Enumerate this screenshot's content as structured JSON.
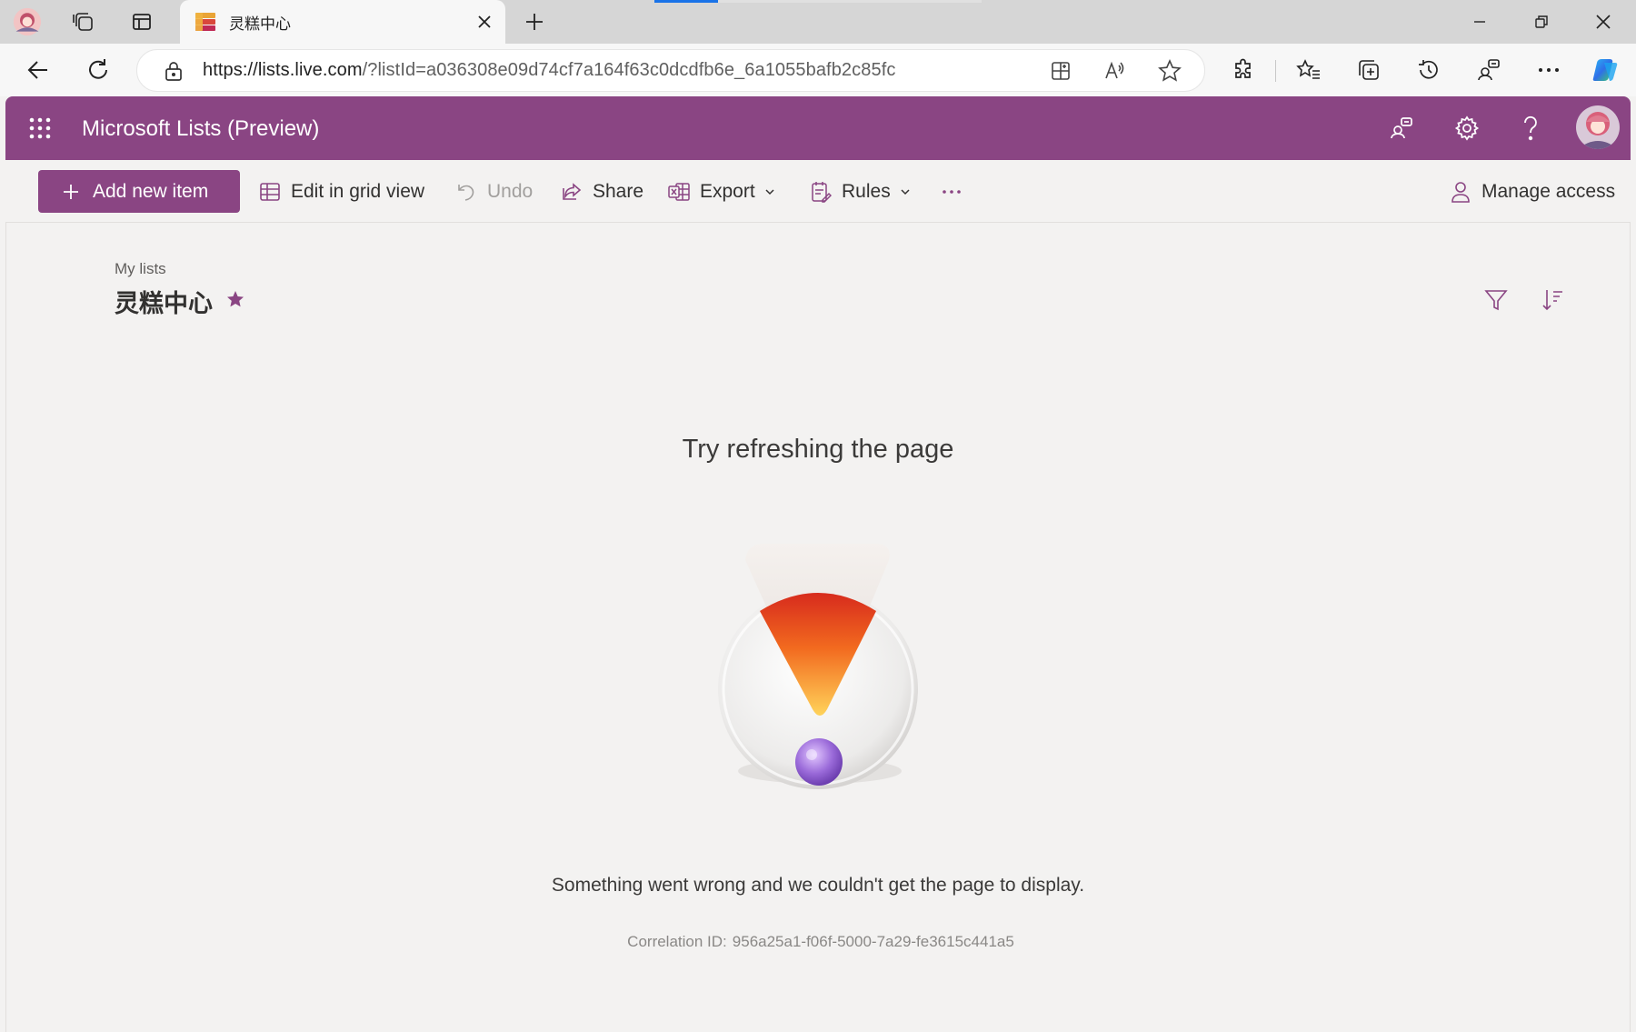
{
  "browser": {
    "tab_title": "灵糕中心",
    "url_host": "https://lists.live.com",
    "url_rest": "/?listId=a036308e09d74cf7a164f63c0dcdfb6e_6a1055bafb2c85fc"
  },
  "app": {
    "title": "Microsoft Lists (Preview)",
    "accent_color": "#8a4583"
  },
  "commands": {
    "add_new_item": "Add new item",
    "edit_grid": "Edit in grid view",
    "undo": "Undo",
    "share": "Share",
    "export": "Export",
    "rules": "Rules",
    "manage_access": "Manage access"
  },
  "list": {
    "breadcrumb": "My lists",
    "title": "灵糕中心"
  },
  "error": {
    "title": "Try refreshing the page",
    "message": "Something went wrong and we couldn't get the page to display.",
    "correlation_label": "Correlation ID:",
    "correlation_id": "956a25a1-f06f-5000-7a29-fe3615c441a5"
  }
}
